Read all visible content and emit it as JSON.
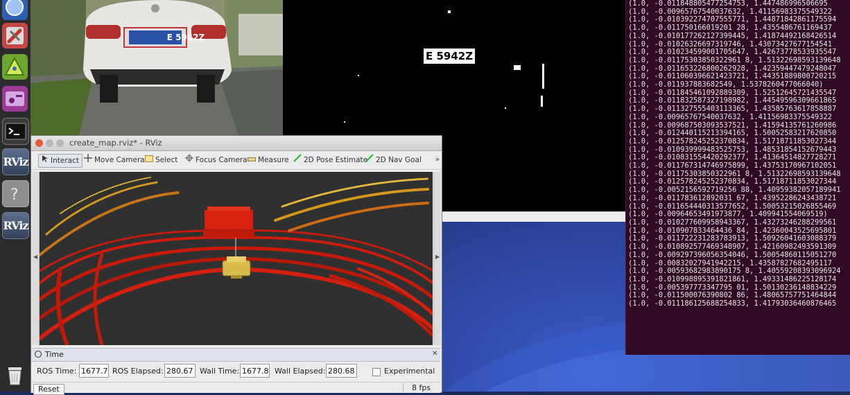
{
  "camera": {
    "plate_text": "E 5942Z"
  },
  "binary": {
    "plate_text": "E 5942Z"
  },
  "rviz": {
    "title": "create_map.rviz* - RViz",
    "toolbar": {
      "interact": "Interact",
      "move_camera": "Move Camera",
      "select": "Select",
      "focus_camera": "Focus Camera",
      "measure": "Measure",
      "pose_estimate": "2D Pose Estimate",
      "nav_goal": "2D Nav Goal",
      "more": "»"
    },
    "time_panel": {
      "title": "Time",
      "ros_time_label": "ROS Time:",
      "ros_time_value": "1677.78",
      "ros_elapsed_label": "ROS Elapsed:",
      "ros_elapsed_value": "280.67",
      "wall_time_label": "Wall Time:",
      "wall_time_value": "1677.88",
      "wall_elapsed_label": "Wall Elapsed:",
      "wall_elapsed_value": "280.68",
      "experimental_label": "Experimental"
    },
    "reset_label": "Reset",
    "fps": "8 fps"
  },
  "launcher": {
    "rviz_label": "RViz",
    "colors": {
      "bg": "#2b2b2e",
      "tile": "#4a5a74"
    }
  },
  "terminal": {
    "lines": [
      "(1.0, -0.011848805477254753, 1.447486996506695",
      "(1.0, -0.00965767540037632, 1.41156983375549322",
      "(1.0, -0.010392274707555771, 1.44871842861175594",
      "(1.0, -0.011750166019201 28, 1.4355486761169437",
      "(1.0, -0.010177262127399445, 1.41874492168426514",
      "(1.0, -0.01026326697319746, 1.43073427677154541",
      "(1.0, -0.010234599001705647, 1.42673778533935547",
      "(1.0, -0.01175303850322961 8, 1.51322698593139648",
      "(1.0, -0.011653226800262928, 1.42359447479248047",
      "(1.0, -0.011060396621423721, 1.44351889800720215",
      "(1.0, -0.011937883682549, 1.5378260477066040)",
      "(1.0, -0.011845461092889309, 1.52512645721435547",
      "(1.0, -0.011832587327198982, 1.44549596309661865",
      "(1.0, -0.011327555403113365, 1.43585763617858887",
      "(1.0, -0.00965767540037632, 1.41156983375549322",
      "(1.0, -0.009687503093537521, 1.41594135761260986",
      "(1.0, -0.012440115213394165, 1.50052583217620850",
      "(1.0, -0.012578245252370834, 1.51718711853027344",
      "(1.0, -0.010939999483525753, 1.48531854152679443",
      "(1.0, -0.010831554420292377, 1.41364514827728271",
      "(1.0, -0.011767314746975899, 1.43753170967102051",
      "(1.0, -0.01175303850322961 8, 1.51322698593139648",
      "(1.0, -0.012578245252370834, 1.51718711853027344",
      "(1.0, -0.0052156592719256 88, 1.40959382057189941",
      "(1.0, -0.011783612892031 67, 1.43952286243438721",
      "(1.0, -0.011654440313577652, 1.50053215026855469",
      "(1.0, -0.00964653491973877, 1.409941554069519)",
      "(1.0, -0.010277609958943367, 1.43273246288299561",
      "(1.0, -0.010907833464436 84, 1.42360043525695801",
      "(1.0, -0.011722231283783913, 1.50926041603088379",
      "(1.0, -0.010892577469348907, 1.42160982493591309",
      "(1.0, -0.009297396056354046, 1.50054860115051270",
      "(1.0, -0.00832027941942215, 1.43587827682495117",
      "(1.0, -0.00593682983890175 8, 1.40559208393096924",
      "(1.0, -0.010998895391821861, 1.49331486225128174",
      "(1.0, -0.005397773347795 01, 1.50130236148834229",
      "(1.0, -0.011500076390802 86, 1.48065757751464844",
      "(1.0, -0.011186125688254833, 1.41793036460876465"
    ]
  }
}
